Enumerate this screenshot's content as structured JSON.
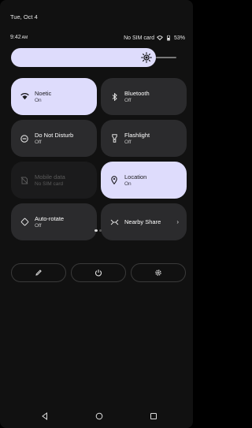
{
  "status_bar": {
    "date": "Tue, Oct 4",
    "time": "9:42",
    "time_suffix": "AM",
    "network": "No SIM card",
    "battery": "53%"
  },
  "brightness": {
    "level": 0.86,
    "icon": "brightness-icon"
  },
  "tiles": [
    {
      "name": "Noetic",
      "sub": "On",
      "state": "on",
      "icon": "wifi-icon"
    },
    {
      "name": "Bluetooth",
      "sub": "Off",
      "state": "off",
      "icon": "bluetooth-icon"
    },
    {
      "name": "Do Not Disturb",
      "sub": "Off",
      "state": "off",
      "icon": "dnd-icon"
    },
    {
      "name": "Flashlight",
      "sub": "Off",
      "state": "off",
      "icon": "flashlight-icon"
    },
    {
      "name": "Mobile data",
      "sub": "No SIM card",
      "state": "disabled",
      "icon": "mobile-data-icon"
    },
    {
      "name": "Location",
      "sub": "On",
      "state": "on",
      "icon": "location-icon"
    },
    {
      "name": "Auto-rotate",
      "sub": "Off",
      "state": "off",
      "icon": "auto-rotate-icon"
    },
    {
      "name": "Nearby Share",
      "sub": "",
      "state": "off",
      "icon": "nearby-share-icon",
      "chevron": "›"
    }
  ],
  "pager": {
    "pages": 2,
    "current": 1
  },
  "actions": [
    {
      "icon": "edit-icon"
    },
    {
      "icon": "power-icon"
    },
    {
      "icon": "settings-icon"
    }
  ],
  "navbar": [
    {
      "icon": "back-icon"
    },
    {
      "icon": "home-icon"
    },
    {
      "icon": "recents-icon"
    }
  ]
}
